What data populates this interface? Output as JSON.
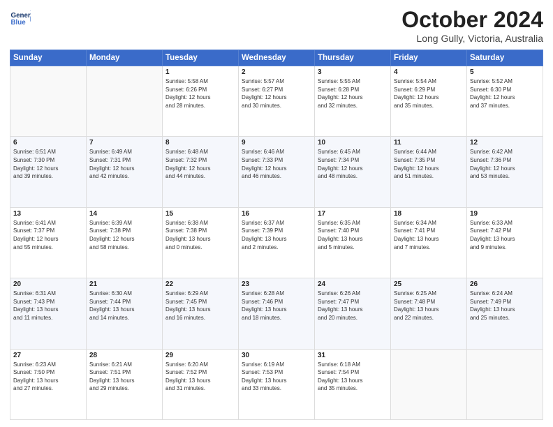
{
  "header": {
    "logo_line1": "General",
    "logo_line2": "Blue",
    "title": "October 2024",
    "subtitle": "Long Gully, Victoria, Australia"
  },
  "days_of_week": [
    "Sunday",
    "Monday",
    "Tuesday",
    "Wednesday",
    "Thursday",
    "Friday",
    "Saturday"
  ],
  "weeks": [
    [
      {
        "day": "",
        "sunrise": "",
        "sunset": "",
        "daylight": ""
      },
      {
        "day": "",
        "sunrise": "",
        "sunset": "",
        "daylight": ""
      },
      {
        "day": "1",
        "sunrise": "Sunrise: 5:58 AM",
        "sunset": "Sunset: 6:26 PM",
        "daylight": "Daylight: 12 hours and 28 minutes."
      },
      {
        "day": "2",
        "sunrise": "Sunrise: 5:57 AM",
        "sunset": "Sunset: 6:27 PM",
        "daylight": "Daylight: 12 hours and 30 minutes."
      },
      {
        "day": "3",
        "sunrise": "Sunrise: 5:55 AM",
        "sunset": "Sunset: 6:28 PM",
        "daylight": "Daylight: 12 hours and 32 minutes."
      },
      {
        "day": "4",
        "sunrise": "Sunrise: 5:54 AM",
        "sunset": "Sunset: 6:29 PM",
        "daylight": "Daylight: 12 hours and 35 minutes."
      },
      {
        "day": "5",
        "sunrise": "Sunrise: 5:52 AM",
        "sunset": "Sunset: 6:30 PM",
        "daylight": "Daylight: 12 hours and 37 minutes."
      }
    ],
    [
      {
        "day": "6",
        "sunrise": "Sunrise: 6:51 AM",
        "sunset": "Sunset: 7:30 PM",
        "daylight": "Daylight: 12 hours and 39 minutes."
      },
      {
        "day": "7",
        "sunrise": "Sunrise: 6:49 AM",
        "sunset": "Sunset: 7:31 PM",
        "daylight": "Daylight: 12 hours and 42 minutes."
      },
      {
        "day": "8",
        "sunrise": "Sunrise: 6:48 AM",
        "sunset": "Sunset: 7:32 PM",
        "daylight": "Daylight: 12 hours and 44 minutes."
      },
      {
        "day": "9",
        "sunrise": "Sunrise: 6:46 AM",
        "sunset": "Sunset: 7:33 PM",
        "daylight": "Daylight: 12 hours and 46 minutes."
      },
      {
        "day": "10",
        "sunrise": "Sunrise: 6:45 AM",
        "sunset": "Sunset: 7:34 PM",
        "daylight": "Daylight: 12 hours and 48 minutes."
      },
      {
        "day": "11",
        "sunrise": "Sunrise: 6:44 AM",
        "sunset": "Sunset: 7:35 PM",
        "daylight": "Daylight: 12 hours and 51 minutes."
      },
      {
        "day": "12",
        "sunrise": "Sunrise: 6:42 AM",
        "sunset": "Sunset: 7:36 PM",
        "daylight": "Daylight: 12 hours and 53 minutes."
      }
    ],
    [
      {
        "day": "13",
        "sunrise": "Sunrise: 6:41 AM",
        "sunset": "Sunset: 7:37 PM",
        "daylight": "Daylight: 12 hours and 55 minutes."
      },
      {
        "day": "14",
        "sunrise": "Sunrise: 6:39 AM",
        "sunset": "Sunset: 7:38 PM",
        "daylight": "Daylight: 12 hours and 58 minutes."
      },
      {
        "day": "15",
        "sunrise": "Sunrise: 6:38 AM",
        "sunset": "Sunset: 7:38 PM",
        "daylight": "Daylight: 13 hours and 0 minutes."
      },
      {
        "day": "16",
        "sunrise": "Sunrise: 6:37 AM",
        "sunset": "Sunset: 7:39 PM",
        "daylight": "Daylight: 13 hours and 2 minutes."
      },
      {
        "day": "17",
        "sunrise": "Sunrise: 6:35 AM",
        "sunset": "Sunset: 7:40 PM",
        "daylight": "Daylight: 13 hours and 5 minutes."
      },
      {
        "day": "18",
        "sunrise": "Sunrise: 6:34 AM",
        "sunset": "Sunset: 7:41 PM",
        "daylight": "Daylight: 13 hours and 7 minutes."
      },
      {
        "day": "19",
        "sunrise": "Sunrise: 6:33 AM",
        "sunset": "Sunset: 7:42 PM",
        "daylight": "Daylight: 13 hours and 9 minutes."
      }
    ],
    [
      {
        "day": "20",
        "sunrise": "Sunrise: 6:31 AM",
        "sunset": "Sunset: 7:43 PM",
        "daylight": "Daylight: 13 hours and 11 minutes."
      },
      {
        "day": "21",
        "sunrise": "Sunrise: 6:30 AM",
        "sunset": "Sunset: 7:44 PM",
        "daylight": "Daylight: 13 hours and 14 minutes."
      },
      {
        "day": "22",
        "sunrise": "Sunrise: 6:29 AM",
        "sunset": "Sunset: 7:45 PM",
        "daylight": "Daylight: 13 hours and 16 minutes."
      },
      {
        "day": "23",
        "sunrise": "Sunrise: 6:28 AM",
        "sunset": "Sunset: 7:46 PM",
        "daylight": "Daylight: 13 hours and 18 minutes."
      },
      {
        "day": "24",
        "sunrise": "Sunrise: 6:26 AM",
        "sunset": "Sunset: 7:47 PM",
        "daylight": "Daylight: 13 hours and 20 minutes."
      },
      {
        "day": "25",
        "sunrise": "Sunrise: 6:25 AM",
        "sunset": "Sunset: 7:48 PM",
        "daylight": "Daylight: 13 hours and 22 minutes."
      },
      {
        "day": "26",
        "sunrise": "Sunrise: 6:24 AM",
        "sunset": "Sunset: 7:49 PM",
        "daylight": "Daylight: 13 hours and 25 minutes."
      }
    ],
    [
      {
        "day": "27",
        "sunrise": "Sunrise: 6:23 AM",
        "sunset": "Sunset: 7:50 PM",
        "daylight": "Daylight: 13 hours and 27 minutes."
      },
      {
        "day": "28",
        "sunrise": "Sunrise: 6:21 AM",
        "sunset": "Sunset: 7:51 PM",
        "daylight": "Daylight: 13 hours and 29 minutes."
      },
      {
        "day": "29",
        "sunrise": "Sunrise: 6:20 AM",
        "sunset": "Sunset: 7:52 PM",
        "daylight": "Daylight: 13 hours and 31 minutes."
      },
      {
        "day": "30",
        "sunrise": "Sunrise: 6:19 AM",
        "sunset": "Sunset: 7:53 PM",
        "daylight": "Daylight: 13 hours and 33 minutes."
      },
      {
        "day": "31",
        "sunrise": "Sunrise: 6:18 AM",
        "sunset": "Sunset: 7:54 PM",
        "daylight": "Daylight: 13 hours and 35 minutes."
      },
      {
        "day": "",
        "sunrise": "",
        "sunset": "",
        "daylight": ""
      },
      {
        "day": "",
        "sunrise": "",
        "sunset": "",
        "daylight": ""
      }
    ]
  ]
}
